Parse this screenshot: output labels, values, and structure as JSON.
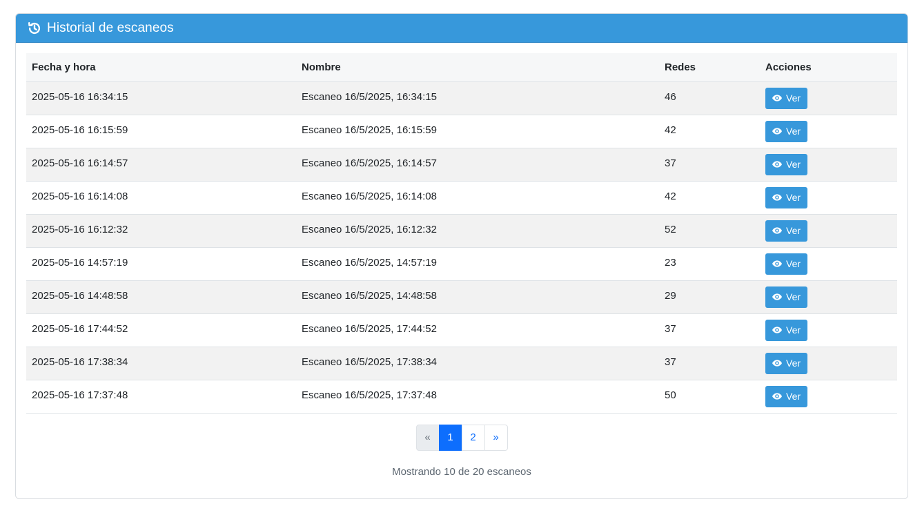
{
  "header": {
    "title": "Historial de escaneos",
    "icon": "history-icon",
    "color": "#3798db"
  },
  "table": {
    "columns": {
      "date": "Fecha y hora",
      "name": "Nombre",
      "count": "Redes",
      "actions": "Acciones"
    },
    "rows": [
      {
        "date": "2025-05-16 16:34:15",
        "name": "Escaneo 16/5/2025, 16:34:15",
        "count": "46",
        "action": "Ver"
      },
      {
        "date": "2025-05-16 16:15:59",
        "name": "Escaneo 16/5/2025, 16:15:59",
        "count": "42",
        "action": "Ver"
      },
      {
        "date": "2025-05-16 16:14:57",
        "name": "Escaneo 16/5/2025, 16:14:57",
        "count": "37",
        "action": "Ver"
      },
      {
        "date": "2025-05-16 16:14:08",
        "name": "Escaneo 16/5/2025, 16:14:08",
        "count": "42",
        "action": "Ver"
      },
      {
        "date": "2025-05-16 16:12:32",
        "name": "Escaneo 16/5/2025, 16:12:32",
        "count": "52",
        "action": "Ver"
      },
      {
        "date": "2025-05-16 14:57:19",
        "name": "Escaneo 16/5/2025, 14:57:19",
        "count": "23",
        "action": "Ver"
      },
      {
        "date": "2025-05-16 14:48:58",
        "name": "Escaneo 16/5/2025, 14:48:58",
        "count": "29",
        "action": "Ver"
      },
      {
        "date": "2025-05-16 17:44:52",
        "name": "Escaneo 16/5/2025, 17:44:52",
        "count": "37",
        "action": "Ver"
      },
      {
        "date": "2025-05-16 17:38:34",
        "name": "Escaneo 16/5/2025, 17:38:34",
        "count": "37",
        "action": "Ver"
      },
      {
        "date": "2025-05-16 17:37:48",
        "name": "Escaneo 16/5/2025, 17:37:48",
        "count": "50",
        "action": "Ver"
      }
    ],
    "action_icon": "eye-icon"
  },
  "pagination": {
    "prev": "«",
    "pages": [
      "1",
      "2"
    ],
    "active_page": "1",
    "next": "»"
  },
  "summary": "Mostrando 10 de 20 escaneos"
}
